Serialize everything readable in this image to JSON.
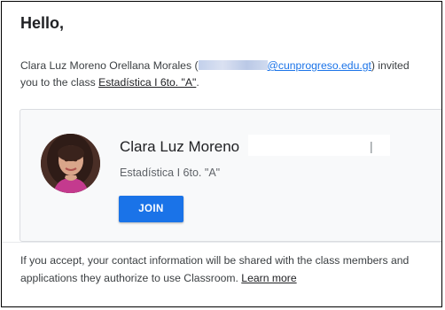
{
  "email": {
    "greeting": "Hello,",
    "invite": {
      "sender_name": "Clara Luz Moreno Orellana Morales",
      "open_paren": " (",
      "email_visible": "@cunprogreso.edu.gt",
      "close_text": ") invited",
      "line2_prefix": "you to the class ",
      "class_link": "Estadística I 6to. \"A\"",
      "period": "."
    },
    "card": {
      "teacher_name": "Clara Luz Moreno",
      "redact_tick": "|",
      "class_name": "Estadística I 6to. \"A\"",
      "join_label": "JOIN"
    },
    "footer": {
      "text": "If you accept, your contact information will be shared with the class members and applications they authorize to use Classroom. ",
      "learn_more": "Learn more"
    }
  },
  "colors": {
    "join_button": "#1a73e8",
    "link": "#1a73e8",
    "card_background": "#f8f9fa"
  }
}
